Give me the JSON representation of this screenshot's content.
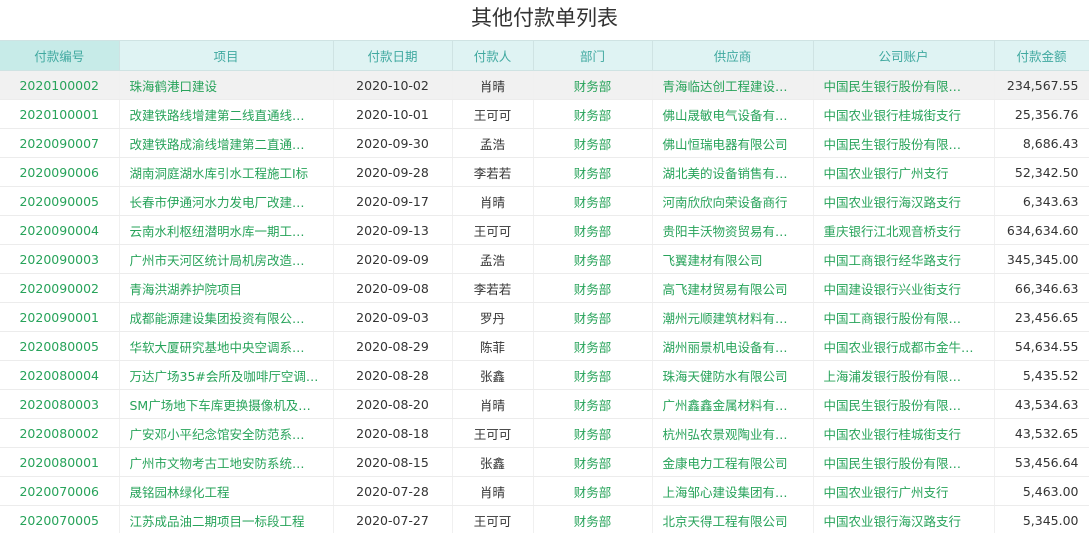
{
  "page": {
    "title": "其他付款单列表"
  },
  "columns": [
    "付款编号",
    "项目",
    "付款日期",
    "付款人",
    "部门",
    "供应商",
    "公司账户",
    "付款金额"
  ],
  "rows": [
    [
      "2020100002",
      "珠海鹤港口建设",
      "2020-10-02",
      "肖晴",
      "财务部",
      "青海临达创工程建设…",
      "中国民生银行股份有限…",
      "234,567.55"
    ],
    [
      "2020100001",
      "改建铁路线增建第二线直通线…",
      "2020-10-01",
      "王可可",
      "财务部",
      "佛山晟敏电气设备有…",
      "中国农业银行桂城街支行",
      "25,356.76"
    ],
    [
      "2020090007",
      "改建铁路成渝线增建第二直通…",
      "2020-09-30",
      "孟浩",
      "财务部",
      "佛山恒瑞电器有限公司",
      "中国民生银行股份有限…",
      "8,686.43"
    ],
    [
      "2020090006",
      "湖南洞庭湖水库引水工程施工I标",
      "2020-09-28",
      "李若若",
      "财务部",
      "湖北美的设备销售有…",
      "中国农业银行广州支行",
      "52,342.50"
    ],
    [
      "2020090005",
      "长春市伊通河水力发电厂改建…",
      "2020-09-17",
      "肖晴",
      "财务部",
      "河南欣欣向荣设备商行",
      "中国农业银行海汉路支行",
      "6,343.63"
    ],
    [
      "2020090004",
      "云南水利枢纽潜明水库一期工…",
      "2020-09-13",
      "王可可",
      "财务部",
      "贵阳丰沃物资贸易有…",
      "重庆银行江北观音桥支行",
      "634,634.60"
    ],
    [
      "2020090003",
      "广州市天河区统计局机房改造…",
      "2020-09-09",
      "孟浩",
      "财务部",
      "飞翼建材有限公司",
      "中国工商银行经华路支行",
      "345,345.00"
    ],
    [
      "2020090002",
      "青海洪湖养护院项目",
      "2020-09-08",
      "李若若",
      "财务部",
      "高飞建材贸易有限公司",
      "中国建设银行兴业街支行",
      "66,346.63"
    ],
    [
      "2020090001",
      "成都能源建设集团投资有限公…",
      "2020-09-03",
      "罗丹",
      "财务部",
      "潮州元顺建筑材料有…",
      "中国工商银行股份有限…",
      "23,456.65"
    ],
    [
      "2020080005",
      "华软大厦研究基地中央空调系…",
      "2020-08-29",
      "陈菲",
      "财务部",
      "湖州丽景机电设备有…",
      "中国农业银行成都市金牛…",
      "54,634.55"
    ],
    [
      "2020080004",
      "万达广场35#会所及咖啡厅空调…",
      "2020-08-28",
      "张鑫",
      "财务部",
      "珠海天健防水有限公司",
      "上海浦发银行股份有限…",
      "5,435.52"
    ],
    [
      "2020080003",
      "SM广场地下车库更换摄像机及…",
      "2020-08-20",
      "肖晴",
      "财务部",
      "广州鑫鑫金属材料有…",
      "中国民生银行股份有限…",
      "43,534.63"
    ],
    [
      "2020080002",
      "广安邓小平纪念馆安全防范系…",
      "2020-08-18",
      "王可可",
      "财务部",
      "杭州弘农景观陶业有…",
      "中国农业银行桂城街支行",
      "43,532.65"
    ],
    [
      "2020080001",
      "广州市文物考古工地安防系统…",
      "2020-08-15",
      "张鑫",
      "财务部",
      "金康电力工程有限公司",
      "中国民生银行股份有限…",
      "53,456.64"
    ],
    [
      "2020070006",
      "晟铭园林绿化工程",
      "2020-07-28",
      "肖晴",
      "财务部",
      "上海邹心建设集团有…",
      "中国农业银行广州支行",
      "5,463.00"
    ],
    [
      "2020070005",
      "江苏成品油二期项目一标段工程",
      "2020-07-27",
      "王可可",
      "财务部",
      "北京天得工程有限公司",
      "中国农业银行海汉路支行",
      "5,345.00"
    ]
  ]
}
